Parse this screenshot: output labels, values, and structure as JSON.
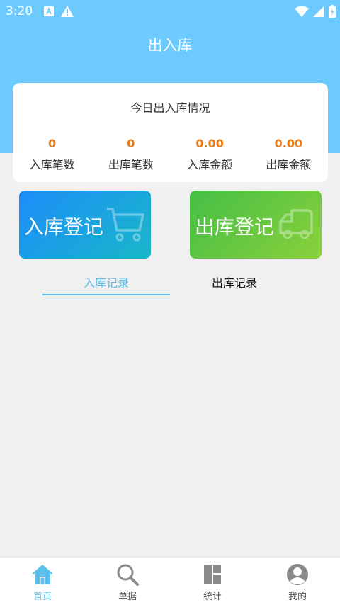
{
  "status_bar": {
    "time": "3:20"
  },
  "header": {
    "title": "出入库"
  },
  "summary": {
    "title": "今日出入库情况",
    "stats": [
      {
        "value": "0",
        "label": "入库笔数"
      },
      {
        "value": "0",
        "label": "出库笔数"
      },
      {
        "value": "0.00",
        "label": "入库金额"
      },
      {
        "value": "0.00",
        "label": "出库金额"
      }
    ]
  },
  "actions": {
    "inbound": {
      "label": "入库登记",
      "icon": "cart-icon"
    },
    "outbound": {
      "label": "出库登记",
      "icon": "truck-icon"
    }
  },
  "tabs": [
    {
      "label": "入库记录",
      "active": true
    },
    {
      "label": "出库记录",
      "active": false
    }
  ],
  "bottom_nav": [
    {
      "label": "首页",
      "icon": "home-icon",
      "active": true
    },
    {
      "label": "单据",
      "icon": "search-icon",
      "active": false
    },
    {
      "label": "统计",
      "icon": "dashboard-icon",
      "active": false
    },
    {
      "label": "我的",
      "icon": "profile-icon",
      "active": false
    }
  ],
  "colors": {
    "header": "#6dcaff",
    "accent": "#5bc0ee",
    "stat_value": "#f07a12",
    "inbound_tile": "#1c8dfa",
    "outbound_tile": "#45be46"
  }
}
